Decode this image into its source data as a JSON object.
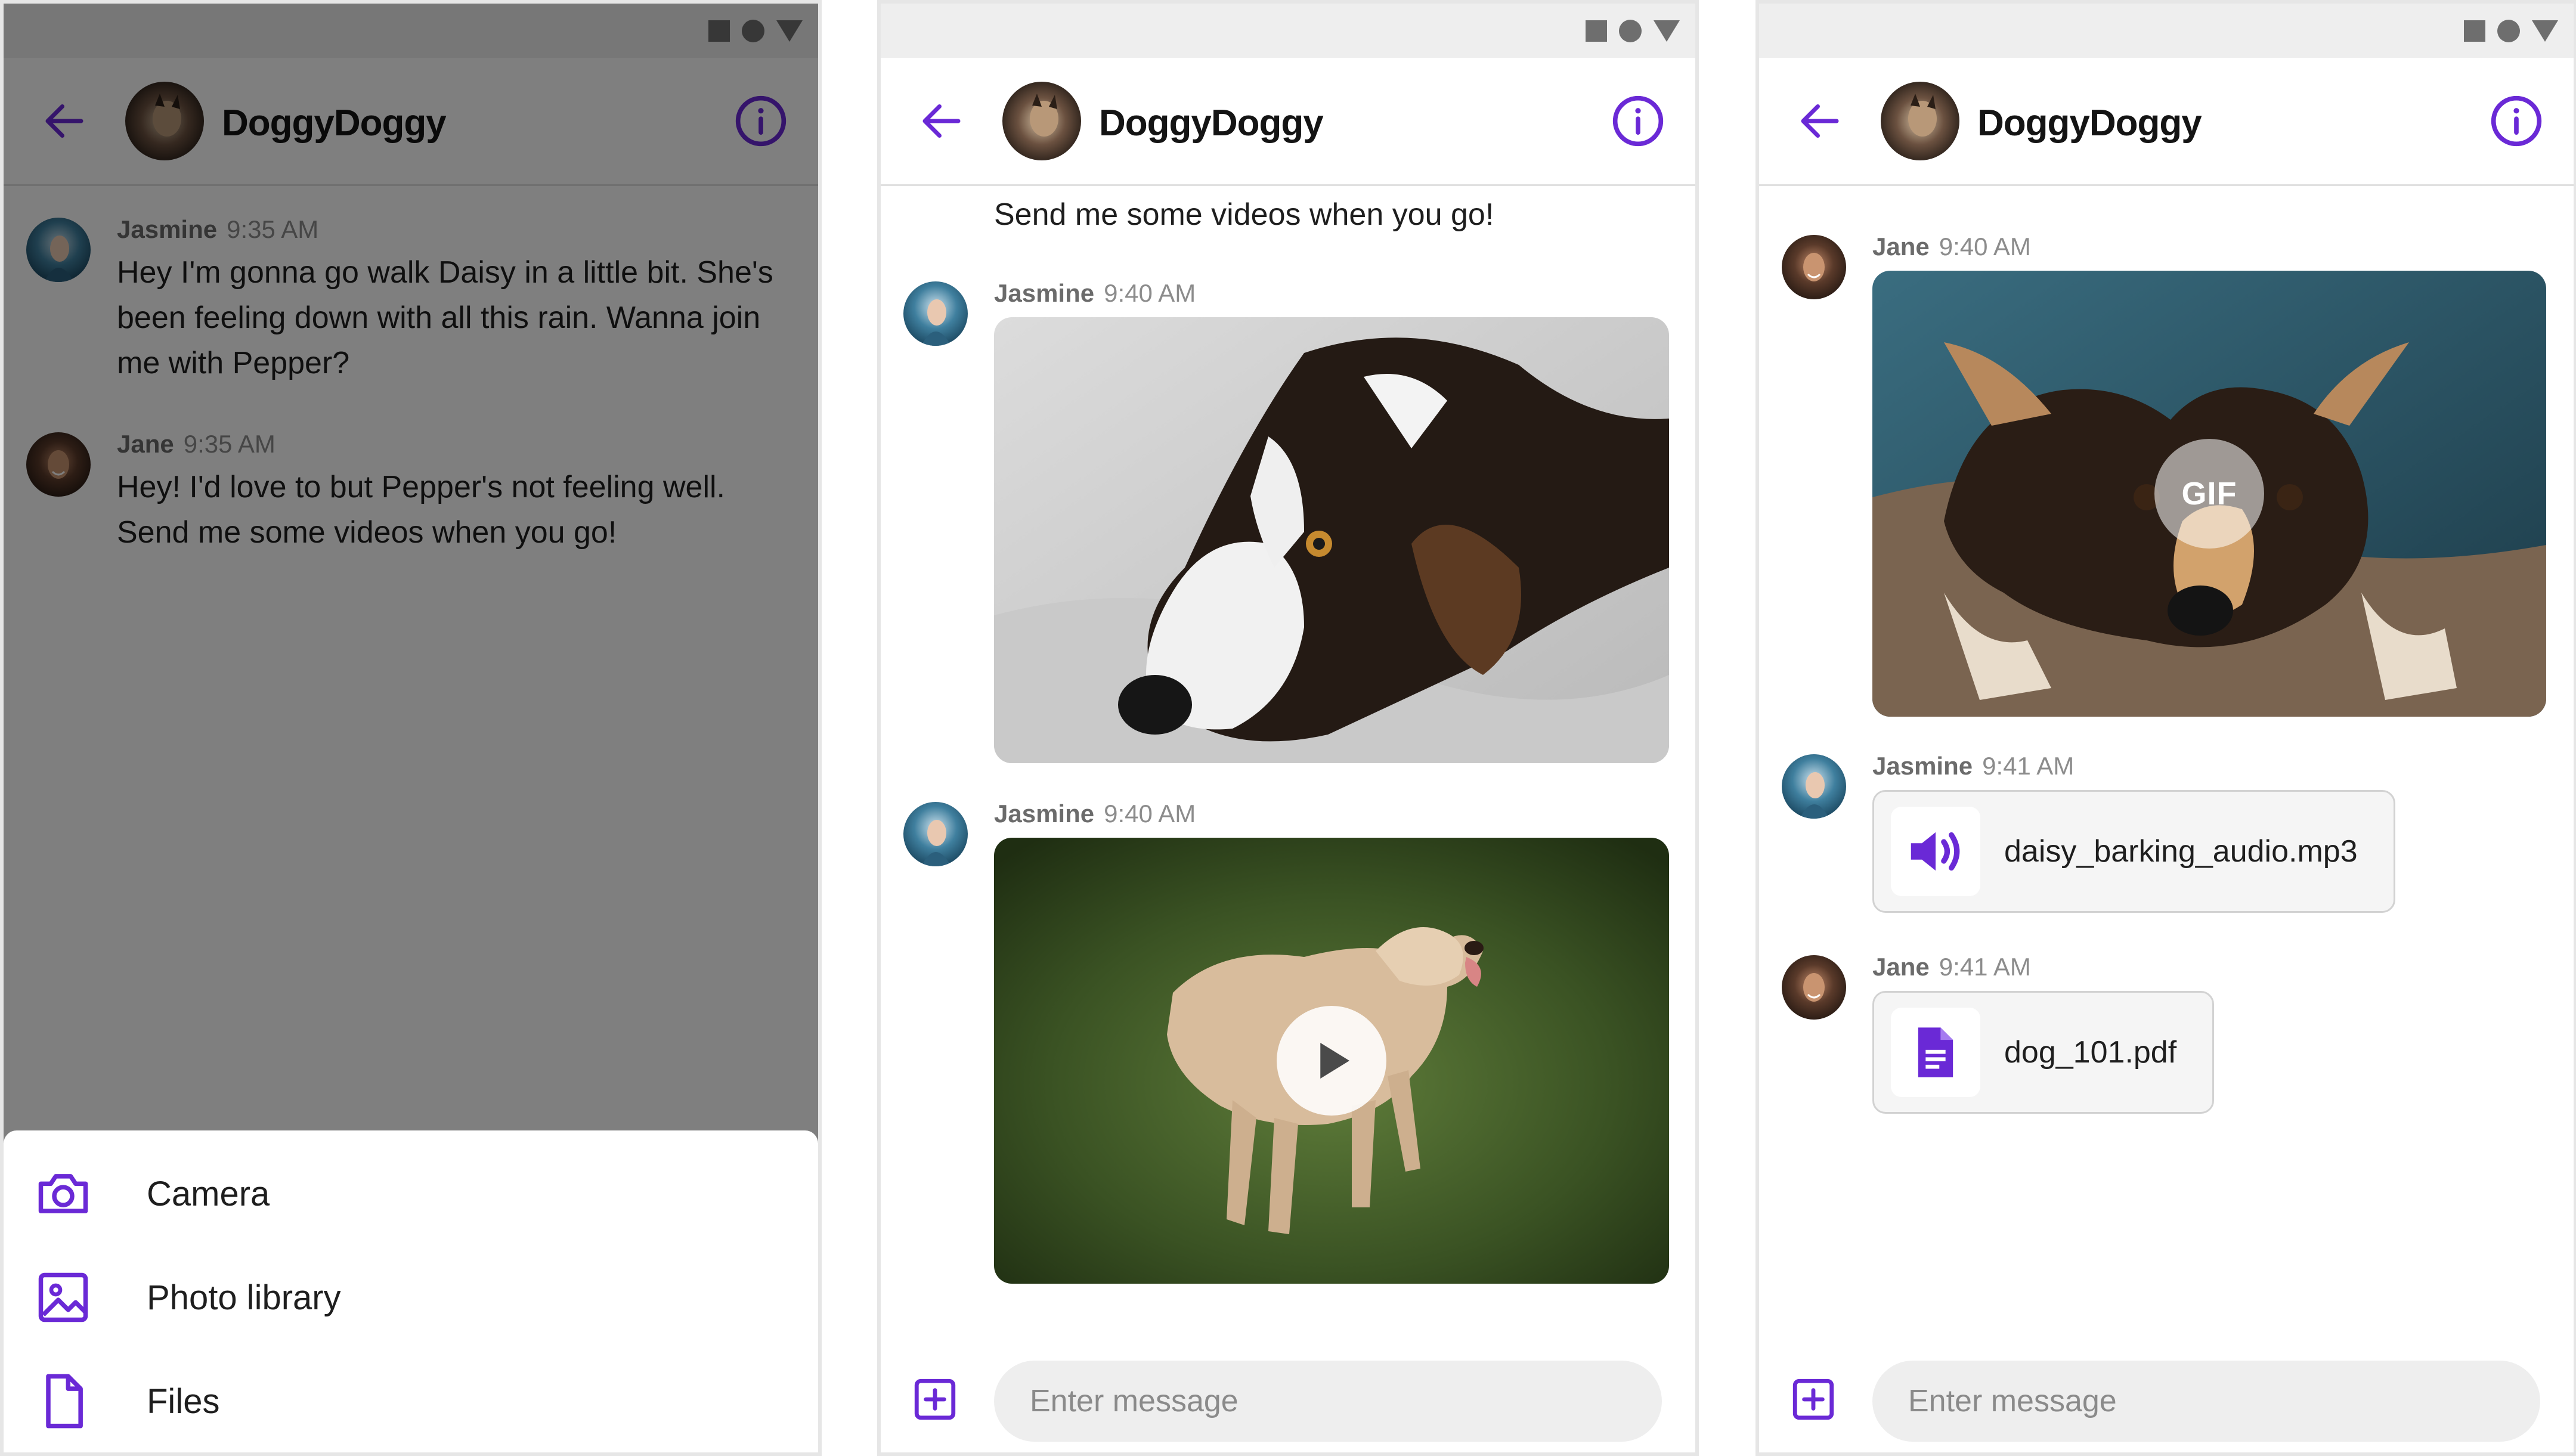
{
  "colors": {
    "accent": "#6a29d6",
    "muted_text": "#8c8c8c",
    "name_text": "#6b6b6b"
  },
  "screens": [
    {
      "channel": {
        "title": "DoggyDoggy"
      },
      "messages": [
        {
          "author": "Jasmine",
          "time": "9:35 AM",
          "text": "Hey I'm gonna go walk Daisy in a little bit. She's been feeling down with all this rain. Wanna join me with Pepper?"
        },
        {
          "author": "Jane",
          "time": "9:35 AM",
          "text": "Hey! I'd love to but Pepper's not feeling well. Send me some videos when you go!"
        }
      ],
      "sheet": [
        {
          "label": "Camera",
          "icon": "camera-icon"
        },
        {
          "label": "Photo library",
          "icon": "photo-library-icon"
        },
        {
          "label": "Files",
          "icon": "file-icon"
        }
      ]
    },
    {
      "channel": {
        "title": "DoggyDoggy"
      },
      "partial_text": "Send me some videos when you go!",
      "messages": [
        {
          "author": "Jasmine",
          "time": "9:40 AM",
          "attachment": "image"
        },
        {
          "author": "Jasmine",
          "time": "9:40 AM",
          "attachment": "video"
        }
      ],
      "composer": {
        "placeholder": "Enter message"
      }
    },
    {
      "channel": {
        "title": "DoggyDoggy"
      },
      "messages": [
        {
          "author": "Jane",
          "time": "9:40 AM",
          "attachment": "gif",
          "overlay_label": "GIF"
        },
        {
          "author": "Jasmine",
          "time": "9:41 AM",
          "attachment": "audio",
          "file_name": "daisy_barking_audio.mp3"
        },
        {
          "author": "Jane",
          "time": "9:41 AM",
          "attachment": "file",
          "file_name": "dog_101.pdf"
        }
      ],
      "composer": {
        "placeholder": "Enter message"
      }
    }
  ]
}
